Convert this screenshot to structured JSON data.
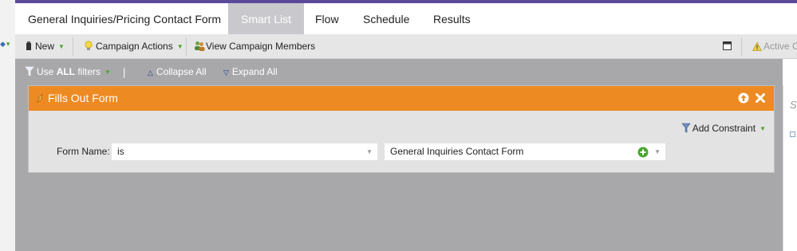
{
  "tabs": [
    {
      "label": "General Inquiries/Pricing Contact Form"
    },
    {
      "label": "Smart List"
    },
    {
      "label": "Flow"
    },
    {
      "label": "Schedule"
    },
    {
      "label": "Results"
    }
  ],
  "active_tab": "Smart List",
  "toolbar": {
    "new_label": "New",
    "campaign_actions_label": "Campaign Actions",
    "view_members_label": "View Campaign Members",
    "active_label": "Active Ca"
  },
  "filterbar": {
    "use_prefix": "Use ",
    "use_all": "ALL",
    "use_suffix": " filters",
    "pipe": "|",
    "collapse_label": "Collapse All",
    "expand_label": "Expand All"
  },
  "filter": {
    "title": "Fills Out Form",
    "add_constraint_label": "Add Constraint",
    "field_label": "Form Name:",
    "operator_value": "is",
    "form_value": "General Inquiries Contact Form"
  },
  "right_panel": {
    "partial_text": "S"
  },
  "colors": {
    "accent_purple": "#5b4a9b",
    "header_orange": "#ee8a22",
    "canvas_gray": "#a8a8ab",
    "active_tab": "#c9c9cd"
  }
}
